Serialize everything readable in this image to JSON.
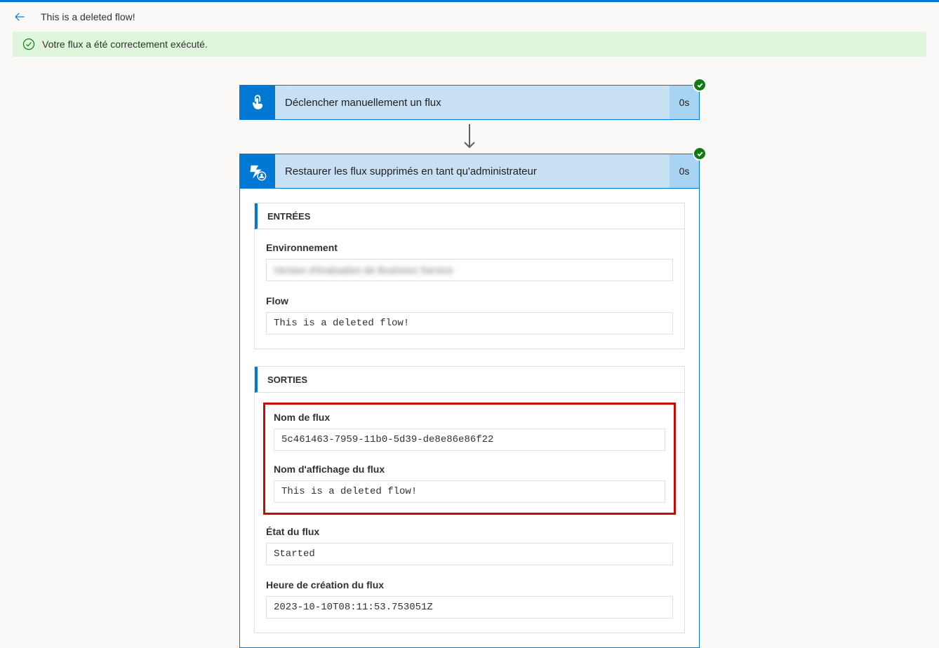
{
  "header": {
    "title": "This is a deleted flow!"
  },
  "banner": {
    "message": "Votre flux a été correctement exécuté."
  },
  "steps": {
    "trigger": {
      "title": "Déclencher manuellement un flux",
      "duration": "0s"
    },
    "restore": {
      "title": "Restaurer les flux supprimés en tant qu'administrateur",
      "duration": "0s",
      "inputs": {
        "section_label": "ENTRÉES",
        "environment": {
          "label": "Environnement",
          "value": "Version d'évaluation de Business Service"
        },
        "flow": {
          "label": "Flow",
          "value": "This is a deleted flow!"
        }
      },
      "outputs": {
        "section_label": "SORTIES",
        "flow_name": {
          "label": "Nom de flux",
          "value": "5c461463-7959-11b0-5d39-de8e86e86f22"
        },
        "flow_display_name": {
          "label": "Nom d'affichage du flux",
          "value": "This is a deleted flow!"
        },
        "flow_state": {
          "label": "État du flux",
          "value": "Started"
        },
        "flow_created": {
          "label": "Heure de création du flux",
          "value": "2023-10-10T08:11:53.753051Z"
        }
      }
    }
  }
}
